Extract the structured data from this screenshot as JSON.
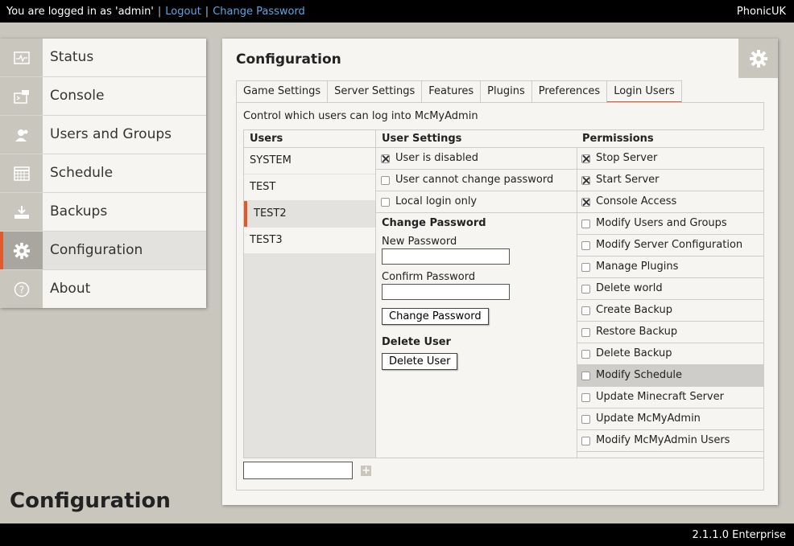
{
  "topbar": {
    "logged_in_text": "You are logged in as 'admin'",
    "sep": "|",
    "logout": "Logout",
    "change_password": "Change Password",
    "server_name": "PhonicUK"
  },
  "footer": {
    "version": "2.1.1.0 Enterprise"
  },
  "sidebar": {
    "items": [
      {
        "label": "Status",
        "icon": "status-icon"
      },
      {
        "label": "Console",
        "icon": "console-icon"
      },
      {
        "label": "Users and Groups",
        "icon": "users-icon"
      },
      {
        "label": "Schedule",
        "icon": "schedule-icon"
      },
      {
        "label": "Backups",
        "icon": "backups-icon"
      },
      {
        "label": "Configuration",
        "icon": "gear-icon",
        "active": true
      },
      {
        "label": "About",
        "icon": "help-icon"
      }
    ]
  },
  "page_title": "Configuration",
  "panel": {
    "title": "Configuration",
    "tabs": [
      "Game Settings",
      "Server Settings",
      "Features",
      "Plugins",
      "Preferences",
      "Login Users"
    ],
    "active_tab": "Login Users",
    "description": "Control which users can log into McMyAdmin"
  },
  "users": {
    "header": "Users",
    "list": [
      "SYSTEM",
      "TEST",
      "TEST2",
      "TEST3"
    ],
    "selected": "TEST2",
    "new_user_value": ""
  },
  "settings": {
    "header": "User Settings",
    "options": [
      {
        "label": "User is disabled",
        "checked": true
      },
      {
        "label": "User cannot change password",
        "checked": false
      },
      {
        "label": "Local login only",
        "checked": false
      }
    ],
    "change_password_title": "Change Password",
    "new_password_label": "New Password",
    "confirm_password_label": "Confirm Password",
    "change_password_button": "Change Password",
    "delete_user_title": "Delete User",
    "delete_user_button": "Delete User"
  },
  "permissions": {
    "header": "Permissions",
    "items": [
      {
        "label": "Stop Server",
        "checked": true
      },
      {
        "label": "Start Server",
        "checked": true
      },
      {
        "label": "Console Access",
        "checked": true
      },
      {
        "label": "Modify Users and Groups",
        "checked": false
      },
      {
        "label": "Modify Server Configuration",
        "checked": false
      },
      {
        "label": "Manage Plugins",
        "checked": false
      },
      {
        "label": "Delete world",
        "checked": false
      },
      {
        "label": "Create Backup",
        "checked": false
      },
      {
        "label": "Restore Backup",
        "checked": false
      },
      {
        "label": "Delete Backup",
        "checked": false
      },
      {
        "label": "Modify Schedule",
        "checked": false,
        "highlighted": true
      },
      {
        "label": "Update Minecraft Server",
        "checked": false
      },
      {
        "label": "Update McMyAdmin",
        "checked": false
      },
      {
        "label": "Modify McMyAdmin Users",
        "checked": false
      }
    ]
  },
  "colors": {
    "accent": "#e05a2b",
    "chrome": "#c9c6be",
    "link": "#5aa6e6"
  }
}
